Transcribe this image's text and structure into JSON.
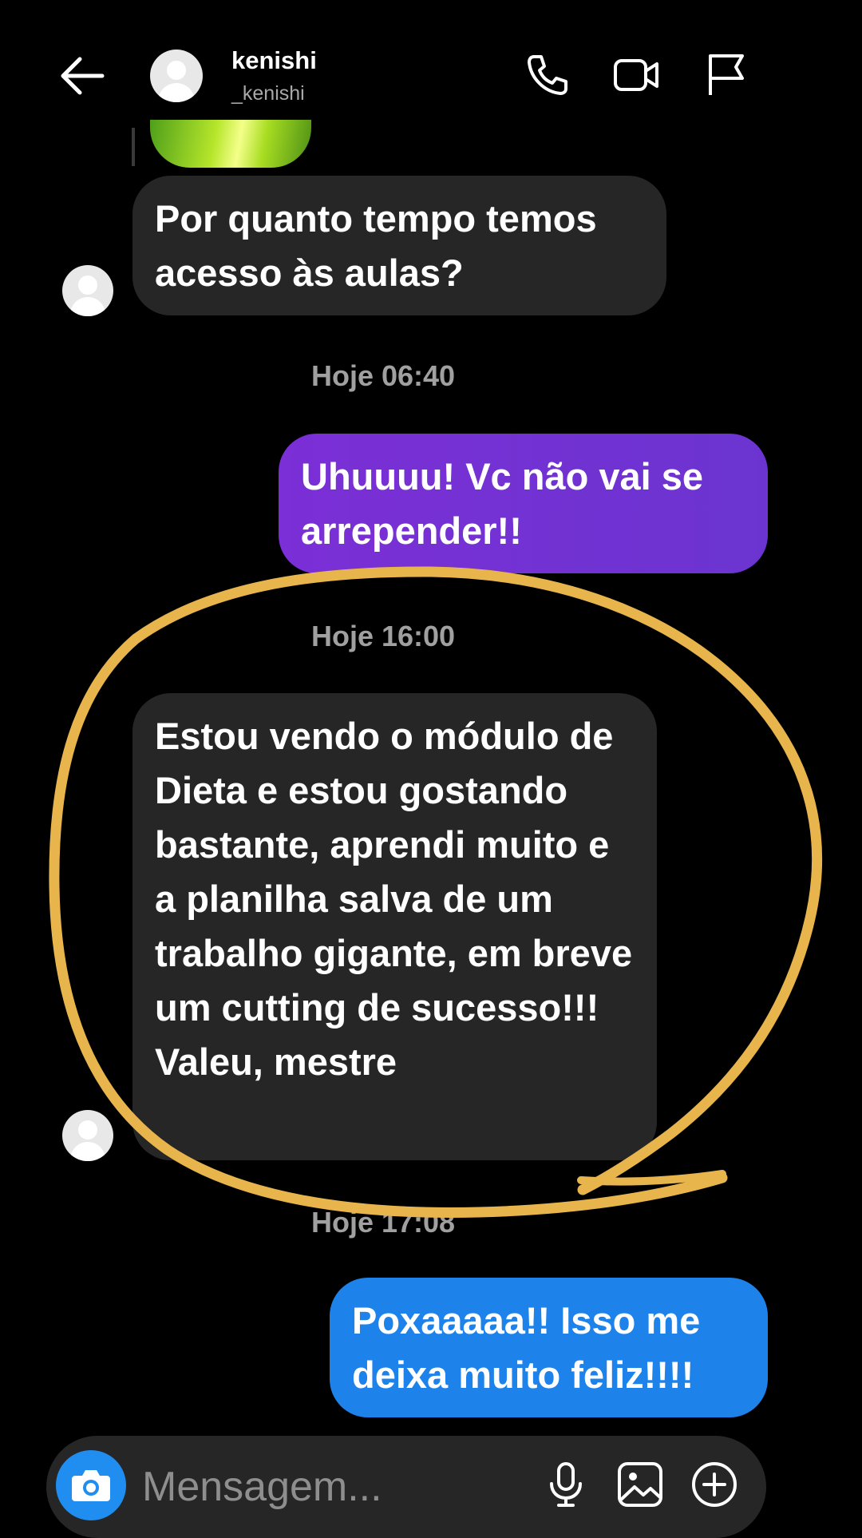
{
  "header": {
    "name": "kenishi",
    "handle": "_kenishi"
  },
  "messages": [
    {
      "from": "contact",
      "text": "Por quanto tempo temos acesso às aulas?"
    },
    {
      "timestamp": "Hoje 06:40"
    },
    {
      "from": "me",
      "text": "Uhuuuu! Vc não vai se arrepender!!"
    },
    {
      "timestamp": "Hoje 16:00"
    },
    {
      "from": "contact",
      "text": "Estou vendo o módulo de Dieta e estou gostando bastante, aprendi muito e a planilha salva de um trabalho gigante, em breve um cutting de sucesso!!! Valeu, mestre"
    },
    {
      "timestamp": "Hoje 17:08"
    },
    {
      "from": "me",
      "text": "Poxaaaaa!! Isso me deixa muito feliz!!!!"
    }
  ],
  "composer": {
    "placeholder": "Mensagem..."
  },
  "icons": {
    "back": "arrow-left-icon",
    "call": "phone-icon",
    "video": "video-camera-icon",
    "report": "flag-icon",
    "camera": "camera-icon",
    "mic": "microphone-icon",
    "gallery": "image-icon",
    "more": "plus-circle-icon"
  },
  "colors": {
    "background": "#000000",
    "incoming_bubble": "#262626",
    "outgoing_purple": "#7b2fd6",
    "outgoing_blue": "#1d82ea",
    "annotation_circle": "#e8b44c"
  }
}
